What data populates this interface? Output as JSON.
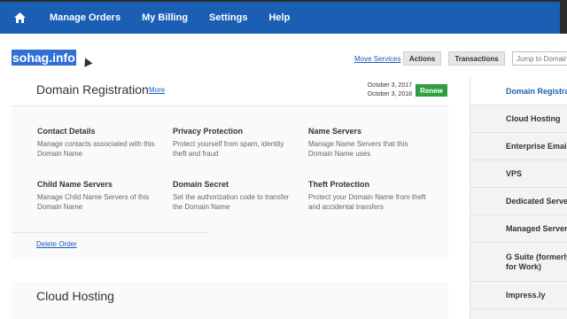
{
  "nav": {
    "items": [
      "Manage Orders",
      "My Billing",
      "Settings",
      "Help"
    ]
  },
  "domain": {
    "name": "sohag.info",
    "move_services": "Move Services",
    "actions_label": "Actions",
    "transactions_label": "Transactions",
    "jump_placeholder": "Jump to Domain"
  },
  "registration": {
    "title": "Domain Registration",
    "more": "More",
    "date_start": "October 3, 2017",
    "date_end": "October 3, 2018",
    "renew": "Renew"
  },
  "features": [
    {
      "title": "Contact Details",
      "desc": "Manage contacts associated with this Domain Name"
    },
    {
      "title": "Privacy Protection",
      "desc": "Protect yourself from spam, identity theft and fraud"
    },
    {
      "title": "Name Servers",
      "desc": "Manage Name Servers that this Domain Name uses"
    },
    {
      "title": "Child Name Servers",
      "desc": "Manage Child Name Servers of this Domain Name"
    },
    {
      "title": "Domain Secret",
      "desc": "Set the authorization code to transfer the Domain Name"
    },
    {
      "title": "Theft Protection",
      "desc": "Protect your Domain Name from theft and accidental transfers"
    }
  ],
  "delete_order": "Delete Order",
  "cloud_title": "Cloud Hosting",
  "sidebar": {
    "items": [
      "Domain Registration",
      "Cloud Hosting",
      "Enterprise Email",
      "VPS",
      "Dedicated Servers",
      "Managed Servers",
      "G Suite (formerly Apps for Work)",
      "Impress.ly"
    ]
  }
}
